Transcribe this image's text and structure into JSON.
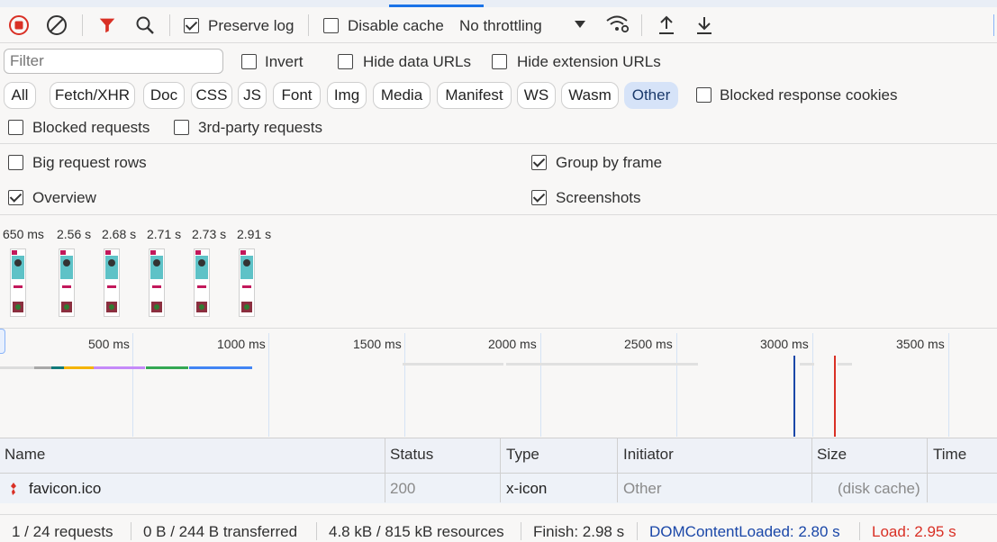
{
  "toolbar": {
    "preserve_log": "Preserve log",
    "disable_cache": "Disable cache",
    "throttling": "No throttling"
  },
  "filter_row": {
    "placeholder": "Filter",
    "invert": "Invert",
    "hide_data_urls": "Hide data URLs",
    "hide_extension_urls": "Hide extension URLs"
  },
  "type_chips": [
    "All",
    "Fetch/XHR",
    "Doc",
    "CSS",
    "JS",
    "Font",
    "Img",
    "Media",
    "Manifest",
    "WS",
    "Wasm",
    "Other"
  ],
  "active_chip": "Other",
  "blocked_response_cookies": "Blocked response cookies",
  "blocked_requests": "Blocked requests",
  "third_party_requests": "3rd-party requests",
  "settings": {
    "big_request_rows": "Big request rows",
    "group_by_frame": "Group by frame",
    "overview": "Overview",
    "screenshots": "Screenshots"
  },
  "screenshot_times": [
    "650 ms",
    "2.56 s",
    "2.68 s",
    "2.71 s",
    "2.73 s",
    "2.91 s"
  ],
  "timeline_ticks": [
    "500 ms",
    "1000 ms",
    "1500 ms",
    "2000 ms",
    "2500 ms",
    "3000 ms",
    "3500 ms"
  ],
  "table": {
    "headers": {
      "name": "Name",
      "status": "Status",
      "type": "Type",
      "initiator": "Initiator",
      "size": "Size",
      "time": "Time"
    },
    "rows": [
      {
        "name": "favicon.ico",
        "status": "200",
        "type": "x-icon",
        "initiator": "Other",
        "size": "(disk cache)",
        "time": ""
      }
    ]
  },
  "status_bar": {
    "requests": "1 / 24 requests",
    "transferred": "0 B / 244 B transferred",
    "resources": "4.8 kB / 815 kB resources",
    "finish": "Finish: 2.98 s",
    "dom_content_loaded": "DOMContentLoaded: 2.80 s",
    "load": "Load: 2.95 s"
  },
  "colors": {
    "accent": "#1a73e8",
    "record_red": "#d93025",
    "dcl_blue": "#1a47a8",
    "load_red": "#d93025",
    "active_chip_bg": "#d6e3f8"
  }
}
